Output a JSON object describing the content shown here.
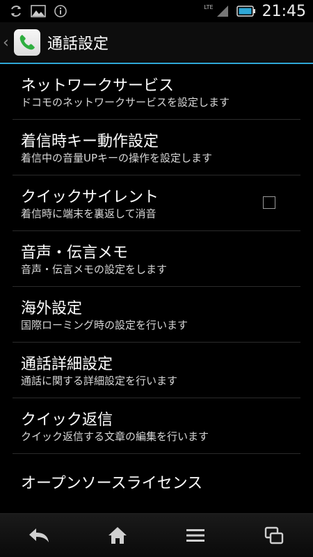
{
  "status_bar": {
    "icons": [
      "sync-icon",
      "image-icon",
      "info-icon"
    ],
    "network": "LTE",
    "time": "21:45"
  },
  "action_bar": {
    "title": "通話設定",
    "app_icon": "phone-icon"
  },
  "accent_color": "#2ea7d6",
  "settings": [
    {
      "title": "ネットワークサービス",
      "subtitle": "ドコモのネットワークサービスを設定します"
    },
    {
      "title": "着信時キー動作設定",
      "subtitle": "着信中の音量UPキーの操作を設定します"
    },
    {
      "title": "クイックサイレント",
      "subtitle": "着信時に端末を裏返して消音",
      "checkbox": false
    },
    {
      "title": "音声・伝言メモ",
      "subtitle": "音声・伝言メモの設定をします"
    },
    {
      "title": "海外設定",
      "subtitle": "国際ローミング時の設定を行います"
    },
    {
      "title": "通話詳細設定",
      "subtitle": "通話に関する詳細設定を行います"
    },
    {
      "title": "クイック返信",
      "subtitle": "クイック返信する文章の編集を行います"
    },
    {
      "title": "オープンソースライセンス"
    }
  ],
  "nav_bar": {
    "buttons": [
      "back-icon",
      "home-icon",
      "menu-icon",
      "recent-apps-icon"
    ]
  }
}
